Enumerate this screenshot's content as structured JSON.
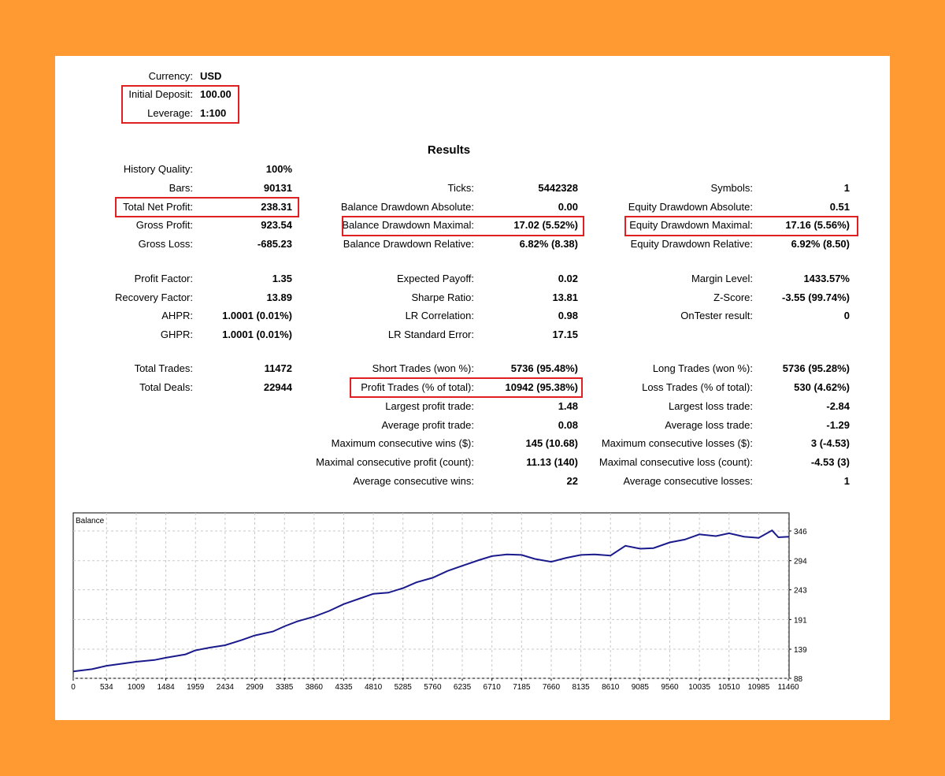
{
  "settings": [
    {
      "label": "Currency:",
      "value": "USD"
    },
    {
      "label": "Initial Deposit:",
      "value": "100.00"
    },
    {
      "label": "Leverage:",
      "value": "1:100"
    }
  ],
  "results_title": "Results",
  "col1": [
    {
      "label": "History Quality:",
      "value": "100%"
    },
    {
      "label": "Bars:",
      "value": "90131"
    },
    {
      "label": "Total Net Profit:",
      "value": "238.31"
    },
    {
      "label": "Gross Profit:",
      "value": "923.54"
    },
    {
      "label": "Gross Loss:",
      "value": "-685.23"
    },
    {
      "label": "Profit Factor:",
      "value": "1.35"
    },
    {
      "label": "Recovery Factor:",
      "value": "13.89"
    },
    {
      "label": "AHPR:",
      "value": "1.0001 (0.01%)"
    },
    {
      "label": "GHPR:",
      "value": "1.0001 (0.01%)"
    },
    {
      "label": "Total Trades:",
      "value": "11472"
    },
    {
      "label": "Total Deals:",
      "value": "22944"
    }
  ],
  "col2": [
    {
      "label": "Ticks:",
      "value": "5442328"
    },
    {
      "label": "Balance Drawdown Absolute:",
      "value": "0.00"
    },
    {
      "label": "Balance Drawdown Maximal:",
      "value": "17.02 (5.52%)"
    },
    {
      "label": "Balance Drawdown Relative:",
      "value": "6.82% (8.38)"
    },
    {
      "label": "Expected Payoff:",
      "value": "0.02"
    },
    {
      "label": "Sharpe Ratio:",
      "value": "13.81"
    },
    {
      "label": "LR Correlation:",
      "value": "0.98"
    },
    {
      "label": "LR Standard Error:",
      "value": "17.15"
    },
    {
      "label": "Short Trades (won %):",
      "value": "5736 (95.48%)"
    },
    {
      "label": "Profit Trades (% of total):",
      "value": "10942 (95.38%)"
    },
    {
      "label": "Largest profit trade:",
      "value": "1.48"
    },
    {
      "label": "Average profit trade:",
      "value": "0.08"
    },
    {
      "label": "Maximum consecutive wins ($):",
      "value": "145 (10.68)"
    },
    {
      "label": "Maximal consecutive profit (count):",
      "value": "11.13 (140)"
    },
    {
      "label": "Average consecutive wins:",
      "value": "22"
    }
  ],
  "col3": [
    {
      "label": "Symbols:",
      "value": "1"
    },
    {
      "label": "Equity Drawdown Absolute:",
      "value": "0.51"
    },
    {
      "label": "Equity Drawdown Maximal:",
      "value": "17.16 (5.56%)"
    },
    {
      "label": "Equity Drawdown Relative:",
      "value": "6.92% (8.50)"
    },
    {
      "label": "Margin Level:",
      "value": "1433.57%"
    },
    {
      "label": "Z-Score:",
      "value": "-3.55 (99.74%)"
    },
    {
      "label": "OnTester result:",
      "value": "0"
    },
    {
      "label": "Long Trades (won %):",
      "value": "5736 (95.28%)"
    },
    {
      "label": "Loss Trades (% of total):",
      "value": "530 (4.62%)"
    },
    {
      "label": "Largest loss trade:",
      "value": "-2.84"
    },
    {
      "label": "Average loss trade:",
      "value": "-1.29"
    },
    {
      "label": "Maximum consecutive losses ($):",
      "value": "3 (-4.53)"
    },
    {
      "label": "Maximal consecutive loss (count):",
      "value": "-4.53 (3)"
    },
    {
      "label": "Average consecutive losses:",
      "value": "1"
    }
  ],
  "colors": {
    "background": "#ff9a33",
    "highlight": "#e02020",
    "line": "#1a1a8c",
    "grid": "#c8c8c8"
  },
  "chart_data": {
    "type": "line",
    "title": "Balance",
    "x_ticks": [
      "0",
      "534",
      "1009",
      "1484",
      "1959",
      "2434",
      "2909",
      "3385",
      "3860",
      "4335",
      "4810",
      "5285",
      "5760",
      "6235",
      "6710",
      "7185",
      "7660",
      "8135",
      "8610",
      "9085",
      "9560",
      "10035",
      "10510",
      "10985",
      "11460"
    ],
    "y_ticks": [
      "346",
      "294",
      "243",
      "191",
      "139",
      "88"
    ],
    "ylim": [
      88,
      346
    ],
    "xlim": [
      0,
      11472
    ],
    "grid": true,
    "series": [
      {
        "x": [
          0,
          300,
          534,
          800,
          1009,
          1300,
          1484,
          1800,
          1959,
          2200,
          2434,
          2700,
          2909,
          3200,
          3385,
          3600,
          3860,
          4100,
          4335,
          4600,
          4810,
          5050,
          5285,
          5500,
          5760,
          6000,
          6235,
          6500,
          6710,
          6950,
          7185,
          7400,
          7660,
          7900,
          8135,
          8350,
          8610,
          8850,
          9085,
          9300,
          9560,
          9800,
          10035,
          10300,
          10510,
          10750,
          10985,
          11200,
          11300,
          11472
        ],
        "values": [
          100,
          104,
          110,
          114,
          117,
          120,
          124,
          130,
          137,
          142,
          146,
          155,
          163,
          170,
          179,
          188,
          196,
          206,
          218,
          228,
          236,
          238,
          246,
          256,
          264,
          276,
          285,
          295,
          302,
          305,
          304,
          297,
          292,
          299,
          304,
          305,
          303,
          320,
          315,
          316,
          326,
          331,
          340,
          337,
          342,
          336,
          334,
          347,
          335,
          336
        ]
      }
    ]
  }
}
